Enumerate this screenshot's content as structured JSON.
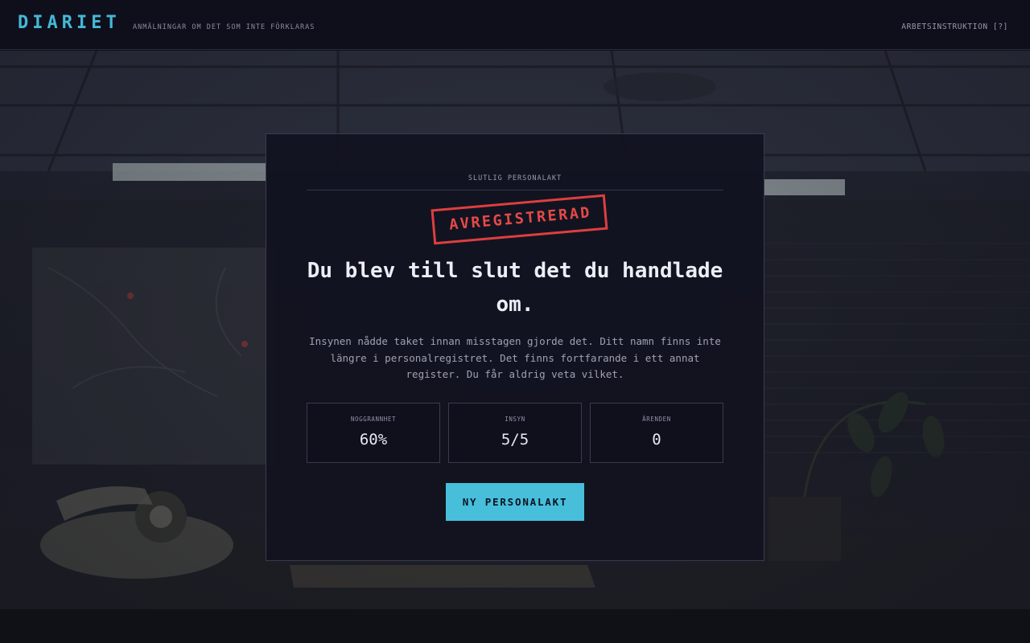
{
  "header": {
    "logo": "DIARIET",
    "tagline": "ANMÄLNINGAR OM DET SOM INTE FÖRKLARAS",
    "help_link": "ARBETSINSTRUKTION [?]"
  },
  "card": {
    "eyebrow": "SLUTLIG PERSONALAKT",
    "stamp": "AVREGISTRERAD",
    "headline": "Du blev till slut det du handlade om.",
    "description": "Insynen nådde taket innan misstagen gjorde det. Ditt namn finns inte längre i personalregistret. Det finns fortfarande i ett annat register. Du får aldrig veta vilket.",
    "stats": [
      {
        "label": "NOGGRANNHET",
        "value": "60%"
      },
      {
        "label": "INSYN",
        "value": "5/5"
      },
      {
        "label": "ÄRENDEN",
        "value": "0"
      }
    ],
    "cta": "NY PERSONALAKT"
  },
  "colors": {
    "accent": "#47bfdb",
    "stamp": "#e54a47",
    "background": "#0d0e19"
  }
}
